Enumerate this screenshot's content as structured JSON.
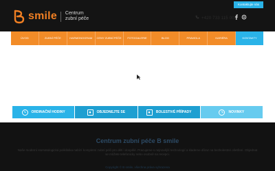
{
  "header": {
    "brand_word": "smile",
    "tagline_line1": "Centrum",
    "tagline_line2": "zubní péče",
    "contact_button": "Kontaktujte nás",
    "phone": "+420 733 115 000",
    "icons": [
      "logo-b-icon",
      "phone-icon",
      "facebook-icon",
      "instagram-icon"
    ]
  },
  "nav": {
    "items": [
      {
        "label": "ÚVOD"
      },
      {
        "label": "ZUBNÍ PÉČE"
      },
      {
        "label": "HARMONOGRAM"
      },
      {
        "label": "CENY ZUBNÍ PÉČE"
      },
      {
        "label": "FOTOGALERIE"
      },
      {
        "label": "BLOG"
      },
      {
        "label": "PRAVIDLA"
      },
      {
        "label": "KARIÉRA"
      },
      {
        "label": "KONTAKTY"
      }
    ],
    "active_index": 8
  },
  "tabs": [
    {
      "label": "ORDINAČNÍ HODINY",
      "icon": "clock-icon"
    },
    {
      "label": "OBJEDNEJTE SE",
      "icon": "camera-icon"
    },
    {
      "label": "BOLESTIVÉ PŘÍPADY",
      "icon": "camera-icon"
    },
    {
      "label": "NOVINKY",
      "icon": "clock-icon"
    }
  ],
  "footer": {
    "title": "Centrum zubní péče B smile",
    "text": "Naše moderní stomatologická poliklinika nabízí kompletní zubní péči pro děti i dospělé. Pracujeme s nejnovější technologií a klademe důraz na bezbolestné ošetření. Objednat se můžete telefonicky nebo osobně na recepci.",
    "bottom": "Copyright © B smile, všechna práva vyhrazena"
  },
  "colors": {
    "orange": "#f28c28",
    "blue": "#2ab3e8",
    "dark": "#141414"
  }
}
